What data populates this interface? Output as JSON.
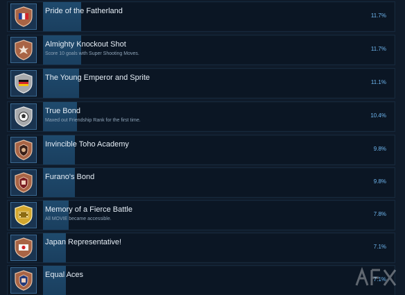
{
  "achievements": [
    {
      "title": "Pride of the Fatherland",
      "description": "",
      "percent": "11.7%",
      "percent_value": 11.7,
      "icon": "france-flag-shield-icon"
    },
    {
      "title": "Almighty Knockout Shot",
      "description": "Score 10 goals with Super Shooting Moves.",
      "percent": "11.7%",
      "percent_value": 11.7,
      "icon": "burst-shield-icon"
    },
    {
      "title": "The Young Emperor and Sprite",
      "description": "",
      "percent": "11.1%",
      "percent_value": 11.1,
      "icon": "germany-flag-shield-icon"
    },
    {
      "title": "True Bond",
      "description": "Maxed out Friendship Rank for the first time.",
      "percent": "10.4%",
      "percent_value": 10.4,
      "icon": "soccer-ball-shield-icon"
    },
    {
      "title": "Invincible Toho Academy",
      "description": "",
      "percent": "9.8%",
      "percent_value": 9.8,
      "icon": "crest-shield-icon"
    },
    {
      "title": "Furano's Bond",
      "description": "",
      "percent": "9.8%",
      "percent_value": 9.8,
      "icon": "crest-shield-icon"
    },
    {
      "title": "Memory of a Fierce Battle",
      "description": "All MOVIE became accessible.",
      "percent": "7.8%",
      "percent_value": 7.8,
      "icon": "gold-film-shield-icon"
    },
    {
      "title": "Japan Representative!",
      "description": "",
      "percent": "7.1%",
      "percent_value": 7.1,
      "icon": "japan-flag-shield-icon"
    },
    {
      "title": "Equal Aces",
      "description": "",
      "percent": "7.1%",
      "percent_value": 7.1,
      "icon": "crest-shield-icon"
    }
  ],
  "colors": {
    "background": "#0f1b2a",
    "row": "#0b1624",
    "bar": "#1f4a6d",
    "percent": "#6fb7f0",
    "bronze": "#b0704a"
  }
}
